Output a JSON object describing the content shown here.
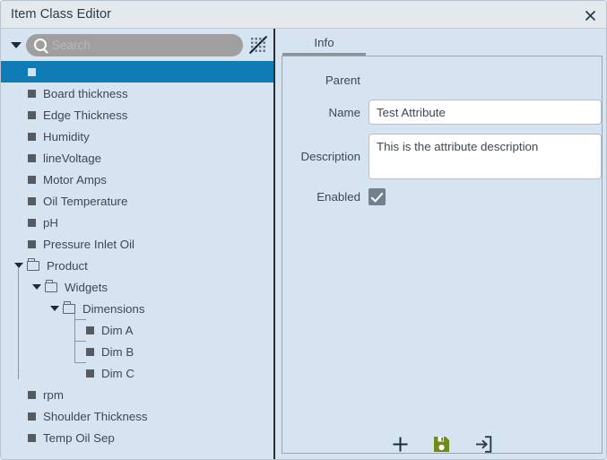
{
  "window": {
    "title": "Item Class Editor",
    "close_icon": "close-icon",
    "close_label": "✕"
  },
  "left_panel": {
    "search": {
      "placeholder": "Search",
      "value": "",
      "icon": "search-icon"
    },
    "toggle_markers_icon": "dotted-grid-slash-icon",
    "root_caret": "chevron-down-icon",
    "tree": [
      {
        "label": "",
        "type": "attribute",
        "depth": 0,
        "selected": true
      },
      {
        "label": "Board thickness",
        "type": "attribute",
        "depth": 0,
        "selected": false
      },
      {
        "label": "Edge Thickness",
        "type": "attribute",
        "depth": 0,
        "selected": false
      },
      {
        "label": "Humidity",
        "type": "attribute",
        "depth": 0,
        "selected": false
      },
      {
        "label": "lineVoltage",
        "type": "attribute",
        "depth": 0,
        "selected": false
      },
      {
        "label": "Motor Amps",
        "type": "attribute",
        "depth": 0,
        "selected": false
      },
      {
        "label": "Oil Temperature",
        "type": "attribute",
        "depth": 0,
        "selected": false
      },
      {
        "label": "pH",
        "type": "attribute",
        "depth": 0,
        "selected": false
      },
      {
        "label": "Pressure Inlet Oil",
        "type": "attribute",
        "depth": 0,
        "selected": false
      },
      {
        "label": "Product",
        "type": "folder",
        "depth": 0,
        "expanded": true,
        "selected": false
      },
      {
        "label": "Widgets",
        "type": "folder",
        "depth": 1,
        "expanded": true,
        "selected": false
      },
      {
        "label": "Dimensions",
        "type": "folder",
        "depth": 2,
        "expanded": true,
        "selected": false
      },
      {
        "label": "Dim A",
        "type": "attribute",
        "depth": 3,
        "selected": false
      },
      {
        "label": "Dim B",
        "type": "attribute",
        "depth": 3,
        "selected": false
      },
      {
        "label": "Dim C",
        "type": "attribute",
        "depth": 3,
        "selected": false
      },
      {
        "label": "rpm",
        "type": "attribute",
        "depth": 0,
        "selected": false
      },
      {
        "label": "Shoulder Thickness",
        "type": "attribute",
        "depth": 0,
        "selected": false
      },
      {
        "label": "Temp Oil Sep",
        "type": "attribute",
        "depth": 0,
        "selected": false
      }
    ]
  },
  "right_panel": {
    "tabs": [
      {
        "label": "Info",
        "active": true
      }
    ],
    "form": {
      "parent_label": "Parent",
      "parent_value": "",
      "name_label": "Name",
      "name_value": "Test Attribute",
      "name_placeholder": "",
      "description_label": "Description",
      "description_value": "This is the attribute description",
      "description_placeholder": "",
      "enabled_label": "Enabled",
      "enabled_checked": true
    }
  },
  "toolbar": {
    "add_label": "+",
    "add_icon": "plus-icon",
    "save_icon": "save-floppy-icon",
    "export_icon": "arrow-into-box-icon"
  },
  "colors": {
    "panel_bg": "#d6e4f2",
    "titlebar_bg": "#e4e9ee",
    "selection": "#0f7cb5",
    "save_green": "#6f8b18",
    "text": "#3d4852",
    "search_bg": "#9f9f9f"
  }
}
